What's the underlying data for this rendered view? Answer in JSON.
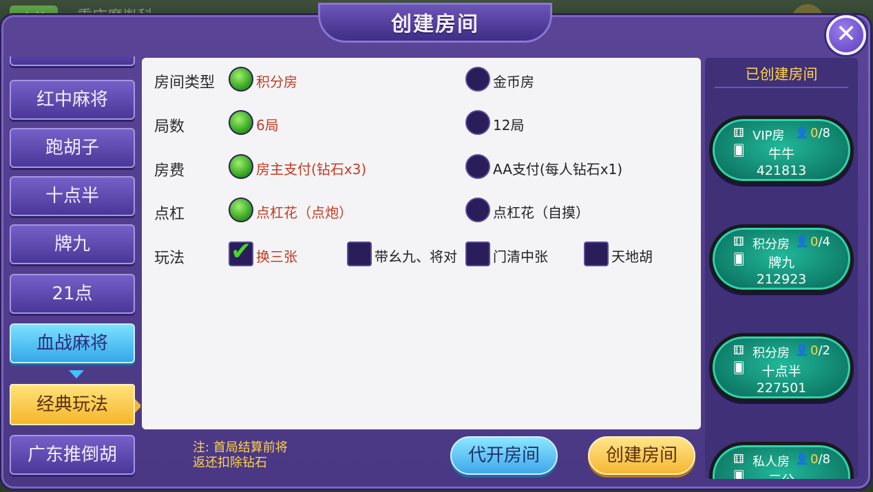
{
  "background": {
    "badge_text": "麻将",
    "game_name": "重庆魔胤科..."
  },
  "dialog": {
    "title": "创建房间",
    "close_icon": "close-icon"
  },
  "games": [
    {
      "label": "红中麻将",
      "active": false
    },
    {
      "label": "跑胡子",
      "active": false
    },
    {
      "label": "十点半",
      "active": false
    },
    {
      "label": "牌九",
      "active": false
    },
    {
      "label": "21点",
      "active": false
    },
    {
      "label": "血战麻将",
      "active": true
    },
    {
      "label": "广东推倒胡",
      "active": false
    }
  ],
  "sub_mode": {
    "label": "经典玩法"
  },
  "options": {
    "room_type": {
      "label": "房间类型",
      "choices": [
        "积分房",
        "金币房"
      ],
      "selected": 0
    },
    "rounds": {
      "label": "局数",
      "choices": [
        "6局",
        "12局"
      ],
      "selected": 0
    },
    "fee": {
      "label": "房费",
      "choices": [
        "房主支付(钻石x3)",
        "AA支付(每人钻石x1)"
      ],
      "selected": 0
    },
    "dian_gang": {
      "label": "点杠",
      "choices": [
        "点杠花（点炮）",
        "点杠花（自摸）"
      ],
      "selected": 0
    },
    "play": {
      "label": "玩法",
      "checks": [
        {
          "label": "换三张",
          "checked": true
        },
        {
          "label": "带幺九、将对",
          "checked": false
        },
        {
          "label": "门清中张",
          "checked": false
        },
        {
          "label": "天地胡",
          "checked": false
        }
      ]
    }
  },
  "footer": {
    "note_line1": "注: 首局结算前将",
    "note_line2": "返还扣除钻石",
    "proxy_button": "代开房间",
    "create_button": "创建房间"
  },
  "created_rooms": {
    "title": "已创建房间",
    "rooms": [
      {
        "type": "VIP房",
        "current": "0",
        "max": "/8",
        "game": "牛牛",
        "id": "421813"
      },
      {
        "type": "积分房",
        "current": "0",
        "max": "/4",
        "game": "牌九",
        "id": "212923"
      },
      {
        "type": "积分房",
        "current": "0",
        "max": "/2",
        "game": "十点半",
        "id": "227501"
      },
      {
        "type": "私人房",
        "current": "0",
        "max": "/8",
        "game": "三公",
        "id": ""
      }
    ]
  },
  "colors": {
    "dialog_purple": "#5a4496",
    "selected_text": "#c63a22",
    "radio_green": "#2b9a1b",
    "accent_yellow": "#ffd54a",
    "room_teal": "#21b89a"
  }
}
